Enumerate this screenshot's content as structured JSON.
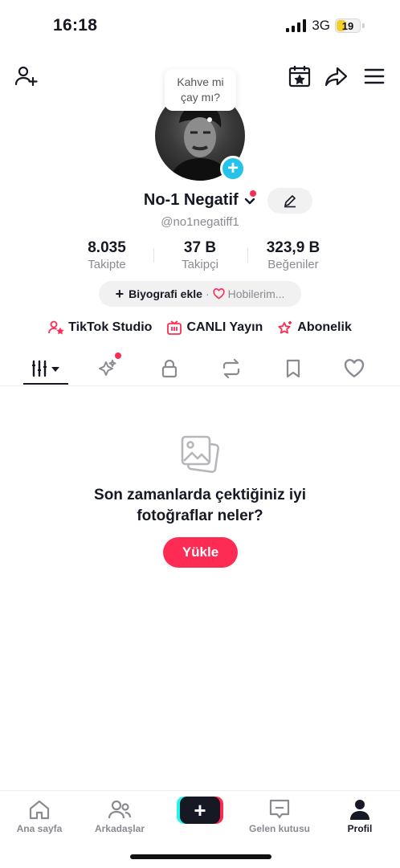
{
  "status": {
    "time": "16:18",
    "network": "3G",
    "battery": "19",
    "battery_level": 0.19
  },
  "header": {
    "add_friend_icon": "add-user-icon",
    "calendar_icon": "calendar-star-icon",
    "share_icon": "share-icon",
    "menu_icon": "menu-icon"
  },
  "profile": {
    "bubble_line1": "Kahve mi",
    "bubble_line2": "çay mı?",
    "name": "No-1 Negatif",
    "handle": "@no1negatiff1",
    "stats": [
      {
        "value": "8.035",
        "label": "Takipte"
      },
      {
        "value": "37 B",
        "label": "Takipçi"
      },
      {
        "value": "323,9 B",
        "label": "Beğeniler"
      }
    ],
    "bio_add": "Biyografi ekle",
    "bio_sep": "·",
    "hobbies": "Hobilerim..."
  },
  "links": [
    {
      "label": "TikTok Studio"
    },
    {
      "label": "CANLI Yayın"
    },
    {
      "label": "Abonelik"
    }
  ],
  "empty": {
    "line1": "Son zamanlarda çektiğiniz iyi",
    "line2": "fotoğraflar neler?",
    "button": "Yükle"
  },
  "nav": {
    "home": "Ana sayfa",
    "friends": "Arkadaşlar",
    "inbox": "Gelen kutusu",
    "profile": "Profil",
    "create": "+"
  },
  "colors": {
    "accent": "#fe2c55",
    "cyan": "#25c3ec",
    "text": "#161823",
    "muted": "#8a8b91"
  }
}
